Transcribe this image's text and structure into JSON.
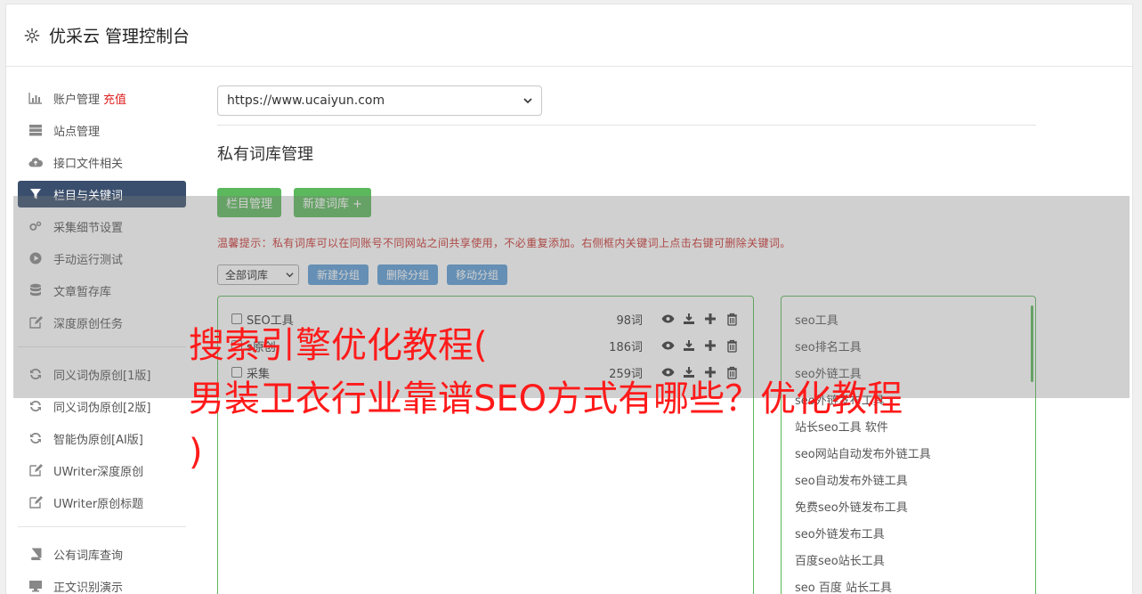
{
  "header": {
    "title": "优采云 管理控制台",
    "icon": "gear-icon"
  },
  "sidebar": {
    "group1": [
      {
        "label": "账户管理",
        "extra": "充值",
        "icon": "bar-chart-icon"
      },
      {
        "label": "站点管理",
        "icon": "server-icon"
      },
      {
        "label": "接口文件相关",
        "icon": "cloud-upload-icon"
      },
      {
        "label": "栏目与关键词",
        "icon": "filter-icon",
        "active": true
      },
      {
        "label": "采集细节设置",
        "icon": "cogs-icon"
      },
      {
        "label": "手动运行测试",
        "icon": "play-circle-icon"
      },
      {
        "label": "文章暂存库",
        "icon": "database-icon"
      },
      {
        "label": "深度原创任务",
        "icon": "edit-icon"
      }
    ],
    "group2": [
      {
        "label": "同义词伪原创[1版]",
        "icon": "refresh-icon"
      },
      {
        "label": "同义词伪原创[2版]",
        "icon": "refresh-icon"
      },
      {
        "label": "智能伪原创[AI版]",
        "icon": "refresh-icon"
      },
      {
        "label": "UWriter深度原创",
        "icon": "edit-icon"
      },
      {
        "label": "UWriter原创标题",
        "icon": "edit-icon"
      }
    ],
    "group3": [
      {
        "label": "公有词库查询",
        "icon": "book-icon"
      },
      {
        "label": "正文识别演示",
        "icon": "monitor-icon"
      }
    ]
  },
  "main": {
    "site_select": "https://www.ucaiyun.com",
    "section_title": "私有词库管理",
    "buttons": {
      "column_manage": "栏目管理",
      "new_library": "新建词库 +"
    },
    "tip": "温馨提示：私有词库可以在同账号不同网站之间共享使用，不必重复添加。右侧框内关键词上点击右键可删除关键词。",
    "group_select": "全部词库",
    "group_buttons": {
      "new_group": "新建分组",
      "delete_group": "删除分组",
      "move_group": "移动分组"
    },
    "libraries": [
      {
        "name": "SEO工具",
        "count": "98词"
      },
      {
        "name": "s原创",
        "count": "186词"
      },
      {
        "name": "采集",
        "count": "259词"
      }
    ],
    "keywords": [
      "seo工具",
      "seo排名工具",
      "seo外链工具",
      "seo外链发布工具",
      "站长seo工具 软件",
      "seo网站自动发布外链工具",
      "seo自动发布外链工具",
      "免费seo外链发布工具",
      "seo外链发布工具",
      "百度seo站长工具",
      "seo 百度 站长工具"
    ]
  },
  "watermark": {
    "line1": "搜索引擎优化教程(",
    "line2": "男装卫衣行业靠谱SEO方式有哪些？优化教程",
    "line3": ")"
  },
  "colors": {
    "active_bg": "#3a4f6d",
    "green": "#5cb85c",
    "blue": "#5b9bd5",
    "tip_red": "#c9302c",
    "watermark_red": "#ff1a1a"
  }
}
